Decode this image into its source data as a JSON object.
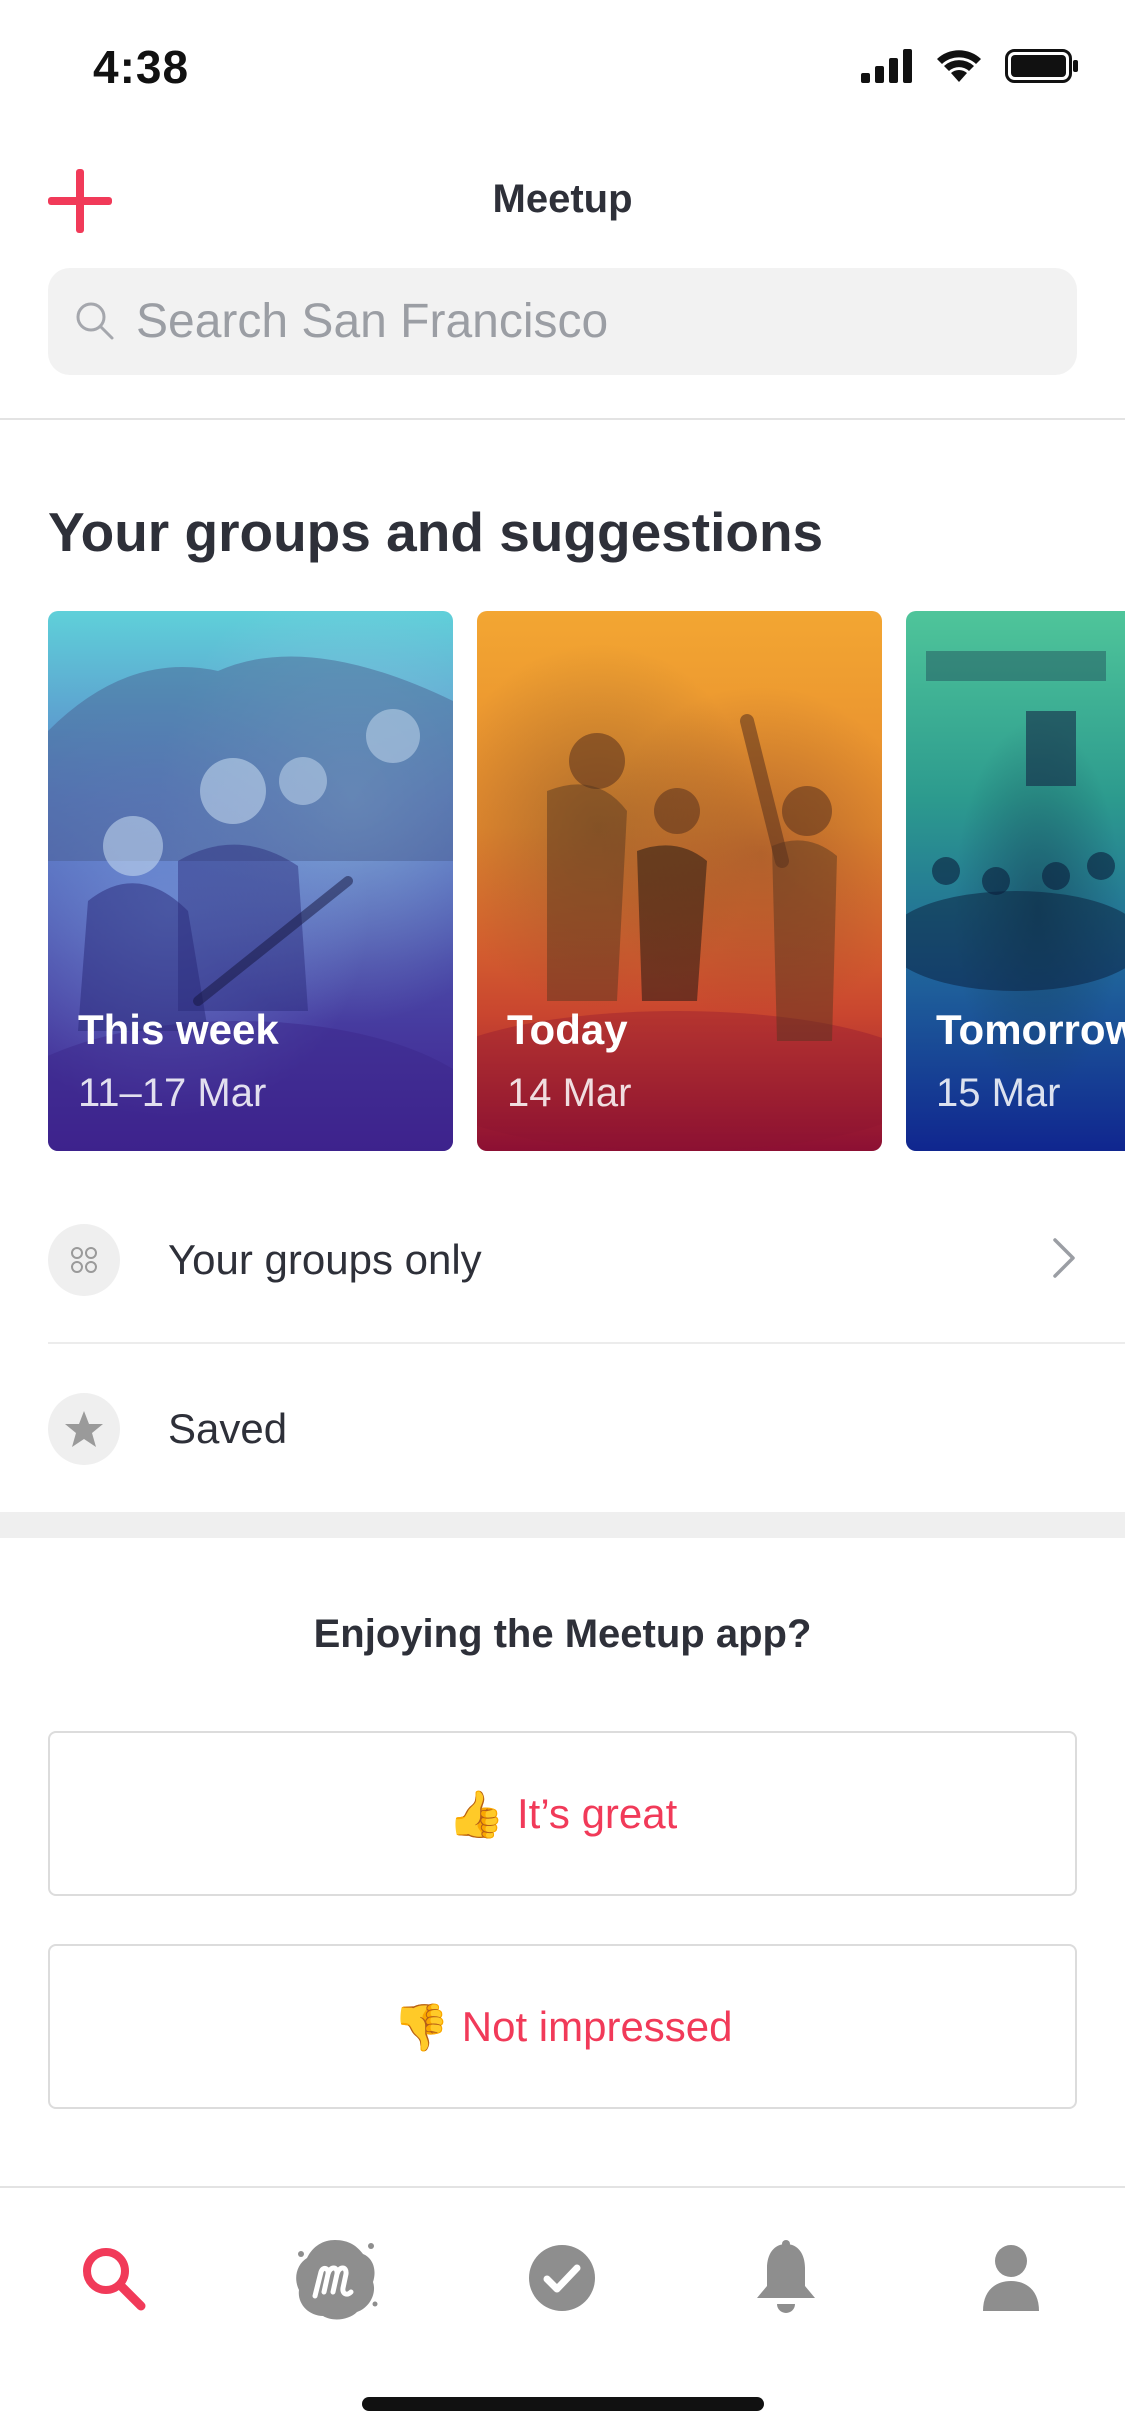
{
  "status_bar": {
    "time": "4:38"
  },
  "header": {
    "title": "Meetup",
    "search_placeholder": "Search San Francisco"
  },
  "section": {
    "title": "Your groups and suggestions"
  },
  "cards": [
    {
      "label": "This week",
      "date": "11–17 Mar"
    },
    {
      "label": "Today",
      "date": "14 Mar"
    },
    {
      "label": "Tomorrow",
      "date": "15 Mar"
    }
  ],
  "list": {
    "groups_only": "Your groups only",
    "saved": "Saved"
  },
  "feedback": {
    "title": "Enjoying the Meetup app?",
    "great_emoji": "👍",
    "great_label": "It’s great",
    "notimp_emoji": "👎",
    "notimp_label": "Not impressed"
  },
  "tabs": [
    {
      "icon": "search-icon",
      "active": true
    },
    {
      "icon": "meetup-logo-icon",
      "active": false
    },
    {
      "icon": "check-circle-icon",
      "active": false
    },
    {
      "icon": "bell-icon",
      "active": false
    },
    {
      "icon": "profile-icon",
      "active": false
    }
  ],
  "colors": {
    "accent": "#f13a59",
    "text": "#2e3039",
    "muted": "#9b9ea4",
    "icon_gray": "#8e8e8e"
  }
}
